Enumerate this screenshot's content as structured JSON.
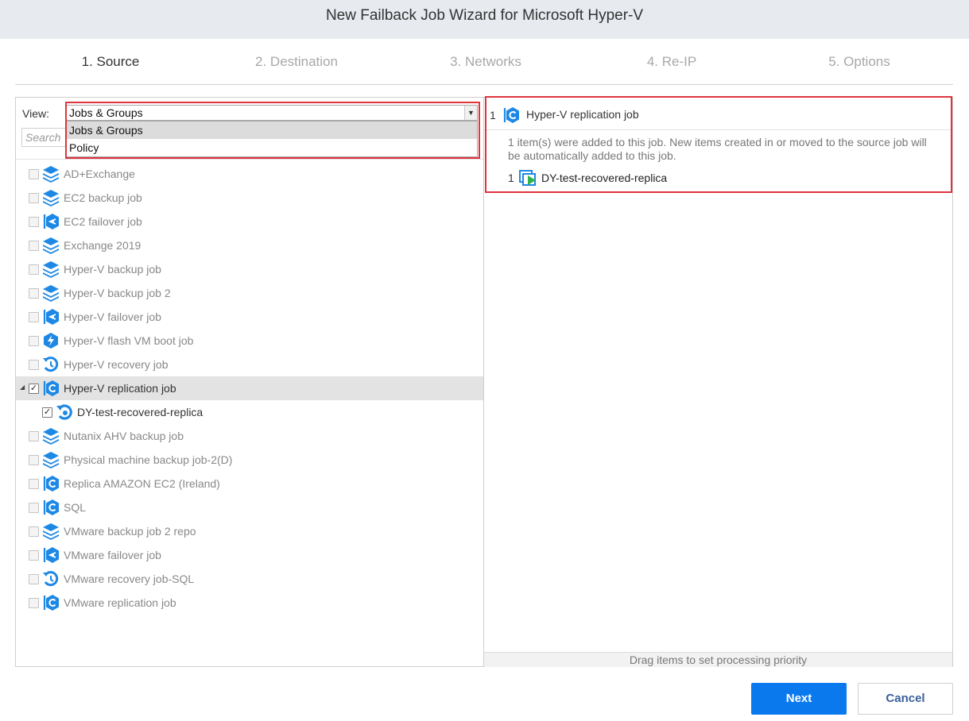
{
  "window": {
    "title": "New Failback Job Wizard for Microsoft Hyper-V"
  },
  "steps": [
    {
      "label": "1. Source",
      "active": true
    },
    {
      "label": "2. Destination",
      "active": false
    },
    {
      "label": "3. Networks",
      "active": false
    },
    {
      "label": "4. Re-IP",
      "active": false
    },
    {
      "label": "5. Options",
      "active": false
    }
  ],
  "source": {
    "view_label": "View:",
    "view_selected": "Jobs & Groups",
    "view_options": [
      "Jobs & Groups",
      "Policy"
    ],
    "search_placeholder": "Search",
    "tree": [
      {
        "label": "AD+Exchange",
        "icon": "backup-job-icon",
        "checked": false
      },
      {
        "label": "EC2 backup job",
        "icon": "backup-job-icon",
        "checked": false
      },
      {
        "label": "EC2 failover job",
        "icon": "failover-job-icon",
        "checked": false
      },
      {
        "label": "Exchange 2019",
        "icon": "backup-job-icon",
        "checked": false
      },
      {
        "label": "Hyper-V backup job",
        "icon": "backup-job-icon",
        "checked": false
      },
      {
        "label": "Hyper-V backup job 2",
        "icon": "backup-job-icon",
        "checked": false
      },
      {
        "label": "Hyper-V failover job",
        "icon": "failover-job-icon",
        "checked": false
      },
      {
        "label": "Hyper-V flash VM boot job",
        "icon": "flash-boot-job-icon",
        "checked": false
      },
      {
        "label": "Hyper-V recovery job",
        "icon": "recovery-job-icon",
        "checked": false
      },
      {
        "label": "Hyper-V replication job",
        "icon": "replication-job-icon",
        "checked": true,
        "expanded": true,
        "selected": true
      },
      {
        "label": "DY-test-recovered-replica",
        "icon": "recovered-replica-icon",
        "checked": true,
        "child": true
      },
      {
        "label": "Nutanix AHV backup job",
        "icon": "backup-job-icon",
        "checked": false
      },
      {
        "label": "Physical machine backup job-2(D)",
        "icon": "backup-job-icon",
        "checked": false
      },
      {
        "label": "Replica AMAZON EC2 (Ireland)",
        "icon": "replication-job-icon",
        "checked": false
      },
      {
        "label": "SQL",
        "icon": "replication-job-icon",
        "checked": false
      },
      {
        "label": "VMware backup job 2 repo",
        "icon": "backup-job-icon",
        "checked": false
      },
      {
        "label": "VMware failover job",
        "icon": "failover-job-icon",
        "checked": false
      },
      {
        "label": "VMware recovery job-SQL",
        "icon": "recovery-job-icon",
        "checked": false
      },
      {
        "label": "VMware replication job",
        "icon": "replication-job-icon",
        "checked": false
      }
    ]
  },
  "selection": {
    "job_index": "1",
    "job_title": "Hyper-V replication job",
    "note": "1 item(s) were added to this job. New items created in or moved to the source job will be automatically added to this job.",
    "item_index": "1",
    "item_label": "DY-test-recovered-replica",
    "drag_hint": "Drag items to set processing priority"
  },
  "buttons": {
    "next": "Next",
    "cancel": "Cancel"
  },
  "colors": {
    "accent": "#0b79ee",
    "icon_blue": "#1e88e5",
    "highlight_red": "#e0343f",
    "vm_green": "#2fb34a"
  }
}
